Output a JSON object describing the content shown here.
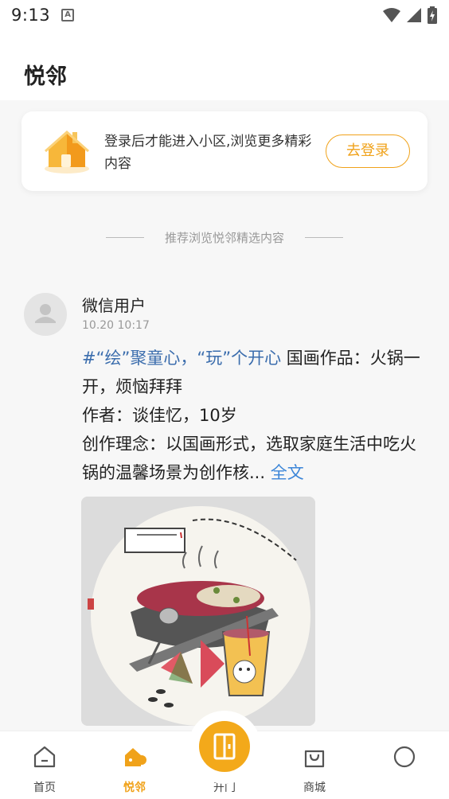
{
  "status_bar": {
    "time": "9:13",
    "a_badge": "A"
  },
  "header": {
    "title": "悦邻"
  },
  "login_card": {
    "message": "登录后才能进入小区,浏览更多精彩内容",
    "button_label": "去登录"
  },
  "divider": {
    "text": "推荐浏览悦邻精选内容"
  },
  "post": {
    "author": "微信用户",
    "time": "10.20 10:17",
    "topic": "#“绘”聚童心，“玩”个开心",
    "text_line1": " 国画作品：火锅一开，烦恼拜拜",
    "text_line2": "作者：谈佳忆，10岁",
    "text_line3": "创作理念：以国画形式，选取家庭生活中吃火锅的温馨场景为创作核...",
    "more_label": "全文"
  },
  "bottom_nav": {
    "items": [
      {
        "label": "首页",
        "icon": "home-icon",
        "active": false
      },
      {
        "label": "悦邻",
        "icon": "neighborhood-icon",
        "active": true
      },
      {
        "label": "开门",
        "icon": "door-icon",
        "active": false
      },
      {
        "label": "商城",
        "icon": "shopping-bag-icon",
        "active": false
      },
      {
        "label": "",
        "icon": "profile-icon",
        "active": false
      }
    ]
  },
  "colors": {
    "accent": "#f0a21a",
    "topic": "#3b6dad",
    "link": "#3b85d8"
  }
}
